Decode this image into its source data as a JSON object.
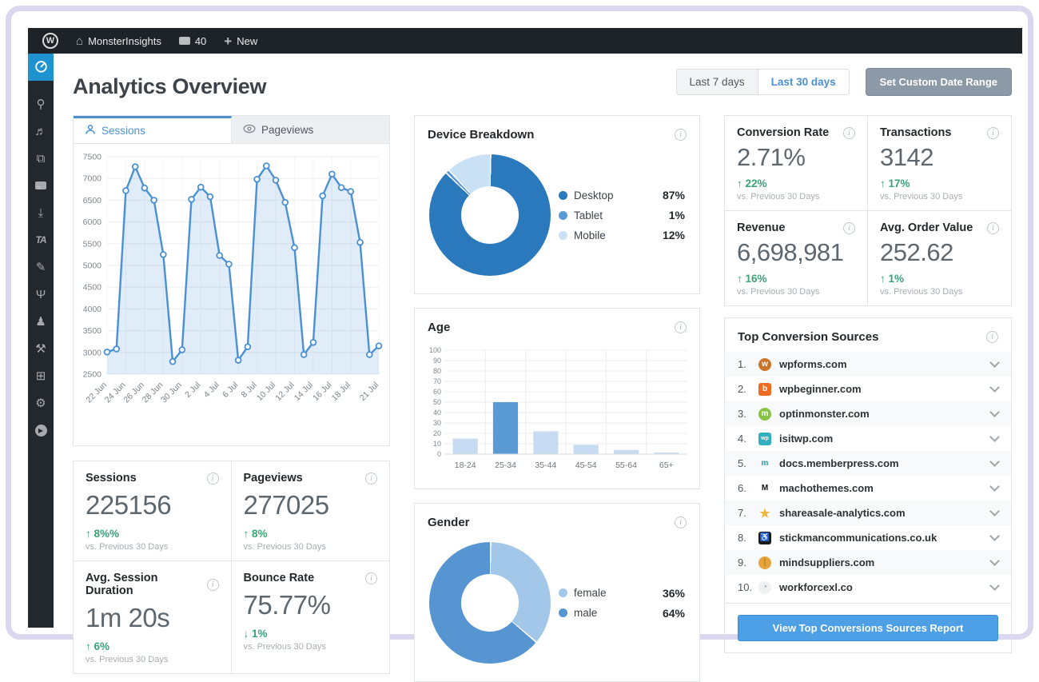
{
  "admin_bar": {
    "site_name": "MonsterInsights",
    "comments_count": "40",
    "new_button": "New"
  },
  "sidebar": {
    "items": [
      {
        "name": "monsterinsights-dashboard",
        "icon": "gauge-icon",
        "active": true
      },
      {
        "name": "posts",
        "icon": "pin-icon"
      },
      {
        "name": "media",
        "icon": "media-icon"
      },
      {
        "name": "pages",
        "icon": "pages-icon"
      },
      {
        "name": "comments",
        "icon": "comment-icon"
      },
      {
        "name": "downloads",
        "icon": "download-icon"
      },
      {
        "name": "ta-menu",
        "icon": "ta-icon",
        "text": "TA"
      },
      {
        "name": "appearance",
        "icon": "brush-icon"
      },
      {
        "name": "plugins",
        "icon": "plug-icon"
      },
      {
        "name": "users",
        "icon": "user-icon"
      },
      {
        "name": "tools",
        "icon": "wrench-icon"
      },
      {
        "name": "settings-panel",
        "icon": "sliders-icon"
      },
      {
        "name": "monsterinsights-settings",
        "icon": "gear-icon"
      },
      {
        "name": "collapse-menu",
        "icon": "play-circle-icon"
      }
    ]
  },
  "header": {
    "title": "Analytics Overview",
    "range_tabs": [
      {
        "label": "Last 7 days",
        "active": false
      },
      {
        "label": "Last 30 days",
        "active": true
      }
    ],
    "custom_range_button": "Set Custom Date Range"
  },
  "overview_tabs": [
    {
      "label": "Sessions",
      "icon": "person-icon",
      "active": true
    },
    {
      "label": "Pageviews",
      "icon": "eye-icon",
      "active": false
    }
  ],
  "chart_data": [
    {
      "type": "line",
      "title": "Sessions over time",
      "x": [
        "22 Jun",
        "23 Jun",
        "24 Jun",
        "25 Jun",
        "26 Jun",
        "27 Jun",
        "28 Jun",
        "29 Jun",
        "30 Jun",
        "1 Jul",
        "2 Jul",
        "3 Jul",
        "4 Jul",
        "5 Jul",
        "6 Jul",
        "7 Jul",
        "8 Jul",
        "9 Jul",
        "10 Jul",
        "11 Jul",
        "12 Jul",
        "13 Jul",
        "14 Jul",
        "15 Jul",
        "16 Jul",
        "17 Jul",
        "18 Jul",
        "19 Jul",
        "20 Jul",
        "21 Jul"
      ],
      "values": [
        3010,
        3080,
        6720,
        7270,
        6780,
        6500,
        5250,
        2790,
        3060,
        6520,
        6800,
        6580,
        5230,
        5030,
        2820,
        3130,
        6980,
        7290,
        6960,
        6450,
        5410,
        2950,
        3230,
        6600,
        7100,
        6790,
        6700,
        5530,
        2950,
        3150
      ],
      "xtick_indices": [
        0,
        2,
        4,
        6,
        8,
        10,
        12,
        14,
        16,
        18,
        20,
        22,
        24,
        26,
        29
      ],
      "ylim": [
        2500,
        7500
      ],
      "ytick_step": 500,
      "grid": true,
      "line_color": "#4a90d2",
      "fill_color": "rgba(74,144,210,0.17)"
    },
    {
      "type": "donut",
      "title": "Device Breakdown",
      "labels": [
        "Desktop",
        "Tablet",
        "Mobile"
      ],
      "values": [
        87,
        1,
        12
      ],
      "display_values": [
        "87%",
        "1%",
        "12%"
      ],
      "colors": [
        "#2b79bd",
        "#5b9bd5",
        "#c9e0f5"
      ],
      "legend_position": "right"
    },
    {
      "type": "bar",
      "title": "Age",
      "categories": [
        "18-24",
        "25-34",
        "35-44",
        "45-54",
        "55-64",
        "65+"
      ],
      "values": [
        15,
        50,
        22,
        9,
        4,
        1.5
      ],
      "ylim": [
        0,
        100
      ],
      "ytick_step": 10,
      "bar_color": "#c7dcf2",
      "highlight_index": 1,
      "highlight_color": "#5b9bd5",
      "grid": true
    },
    {
      "type": "donut",
      "title": "Gender",
      "labels": [
        "female",
        "male"
      ],
      "values": [
        36,
        64
      ],
      "display_values": [
        "36%",
        "64%"
      ],
      "colors": [
        "#a3c7e8",
        "#5695d2"
      ],
      "legend_position": "right"
    }
  ],
  "stat_cards_left": [
    {
      "title": "Sessions",
      "value": "225156",
      "delta": "8%%",
      "direction": "up",
      "note": "vs. Previous 30 Days"
    },
    {
      "title": "Pageviews",
      "value": "277025",
      "delta": "8%",
      "direction": "up",
      "note": "vs. Previous 30 Days"
    },
    {
      "title": "Avg. Session Duration",
      "value": "1m 20s",
      "delta": "6%",
      "direction": "up",
      "note": "vs. Previous 30 Days"
    },
    {
      "title": "Bounce Rate",
      "value": "75.77%",
      "delta": "1%",
      "direction": "down",
      "note": "vs. Previous 30 Days"
    }
  ],
  "stat_cards_right": [
    {
      "title": "Conversion Rate",
      "value": "2.71%",
      "delta": "22%",
      "direction": "up",
      "note": "vs. Previous 30 Days"
    },
    {
      "title": "Transactions",
      "value": "3142",
      "delta": "17%",
      "direction": "up",
      "note": "vs. Previous 30 Days"
    },
    {
      "title": "Revenue",
      "value": "6,698,981",
      "delta": "16%",
      "direction": "up",
      "note": "vs. Previous 30 Days"
    },
    {
      "title": "Avg. Order Value",
      "value": "252.62",
      "delta": "1%",
      "direction": "up",
      "note": "vs. Previous 30 Days"
    }
  ],
  "top_sources": {
    "title": "Top Conversion Sources",
    "rows": [
      {
        "rank": "1.",
        "domain": "wpforms.com",
        "favicon": "wpforms-favicon",
        "fav_bg": "#c9762c",
        "fav_fg": "#ffffff",
        "fav_text": "w",
        "fav_shape": "circle"
      },
      {
        "rank": "2.",
        "domain": "wpbeginner.com",
        "favicon": "wpbeginner-favicon",
        "fav_bg": "#ee6c1f",
        "fav_fg": "#ffffff",
        "fav_text": "b",
        "fav_shape": "square"
      },
      {
        "rank": "3.",
        "domain": "optinmonster.com",
        "favicon": "optinmonster-favicon",
        "fav_bg": "#87c443",
        "fav_fg": "#ffffff",
        "fav_text": "m",
        "fav_shape": "circle"
      },
      {
        "rank": "4.",
        "domain": "isitwp.com",
        "favicon": "isitwp-favicon",
        "fav_bg": "#33b0bd",
        "fav_fg": "#ffffff",
        "fav_text": "wp",
        "fav_shape": "square"
      },
      {
        "rank": "5.",
        "domain": "docs.memberpress.com",
        "favicon": "memberpress-favicon",
        "fav_bg": "transparent",
        "fav_fg": "#27a0a8",
        "fav_text": "m",
        "fav_shape": "none"
      },
      {
        "rank": "6.",
        "domain": "machothemes.com",
        "favicon": "machothemes-favicon",
        "fav_bg": "transparent",
        "fav_fg": "#111111",
        "fav_text": "M",
        "fav_shape": "none"
      },
      {
        "rank": "7.",
        "domain": "shareasale-analytics.com",
        "favicon": "shareasale-favicon",
        "fav_bg": "transparent",
        "fav_fg": "#f2b441",
        "fav_text": "★",
        "fav_shape": "none"
      },
      {
        "rank": "8.",
        "domain": "stickmancommunications.co.uk",
        "favicon": "stickman-favicon",
        "fav_bg": "#1b1b1b",
        "fav_fg": "#ffffff",
        "fav_text": "♿",
        "fav_shape": "square"
      },
      {
        "rank": "9.",
        "domain": "mindsuppliers.com",
        "favicon": "mindsuppliers-favicon",
        "fav_bg": "#e7a33b",
        "fav_fg": "#b87d1e",
        "fav_text": "∣",
        "fav_shape": "circle"
      },
      {
        "rank": "10.",
        "domain": "workforcexl.co",
        "favicon": "workforcexl-favicon",
        "fav_bg": "#eef0f1",
        "fav_fg": "#9aa0a6",
        "fav_text": "◔",
        "fav_shape": "circle"
      }
    ],
    "button": "View Top Conversions Sources Report"
  },
  "colors": {
    "accent_blue": "#4a90d2",
    "active_sidebar": "#1e93d0",
    "positive_green": "#3aa378",
    "frame": "#dad7ee",
    "adminbar": "#1d2327",
    "sidebar": "#23282d"
  }
}
